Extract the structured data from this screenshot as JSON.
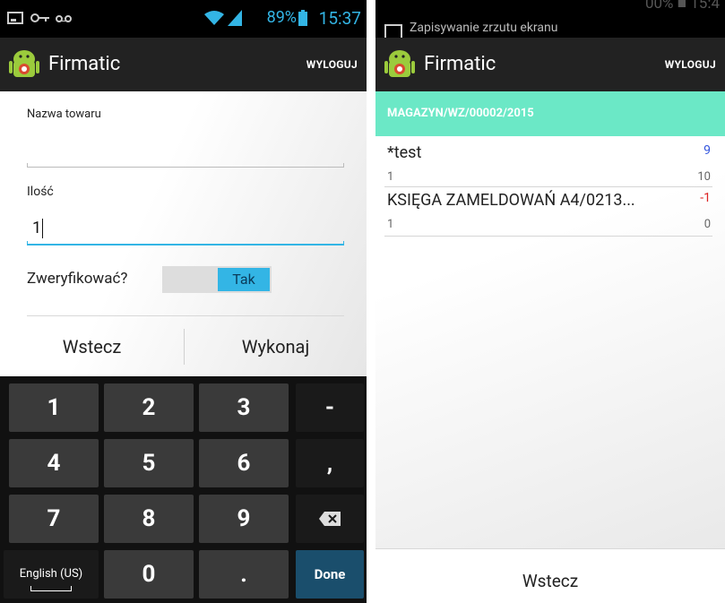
{
  "left": {
    "status": {
      "battery": "89%",
      "time": "15:37"
    },
    "actionbar": {
      "title": "Firmatic",
      "logout": "WYLOGUJ"
    },
    "form": {
      "product_label": "Nazwa towaru",
      "product_value": "",
      "qty_label": "Ilość",
      "qty_value": "1",
      "verify_label": "Zweryfikować?",
      "verify_toggle": "Tak"
    },
    "buttons": {
      "back": "Wstecz",
      "execute": "Wykonaj"
    },
    "keyboard": {
      "row1": [
        "1",
        "2",
        "3",
        "-"
      ],
      "row2": [
        "4",
        "5",
        "6",
        ","
      ],
      "row3": [
        "7",
        "8",
        "9",
        "⌫"
      ],
      "row4": [
        "English (US)",
        "0",
        ".",
        "Done"
      ]
    }
  },
  "right": {
    "status": {
      "toast": "Zapisywanie zrzutu ekranu",
      "time_ghost": "00% ■ 15:4"
    },
    "actionbar": {
      "title": "Firmatic",
      "logout": "WYLOGUJ"
    },
    "document": "MAGAZYN/WZ/00002/2015",
    "items": [
      {
        "name": "*test",
        "count": "9",
        "count_color": "#3355dd",
        "qty": "1",
        "total": "10"
      },
      {
        "name": "KSIĘGA ZAMELDOWAŃ A4/0213...",
        "count": "-1",
        "count_color": "#dd2222",
        "qty": "1",
        "total": "0"
      }
    ],
    "back": "Wstecz"
  },
  "colors": {
    "accent": "#33b5e5",
    "header_green": "#6be8c6"
  }
}
